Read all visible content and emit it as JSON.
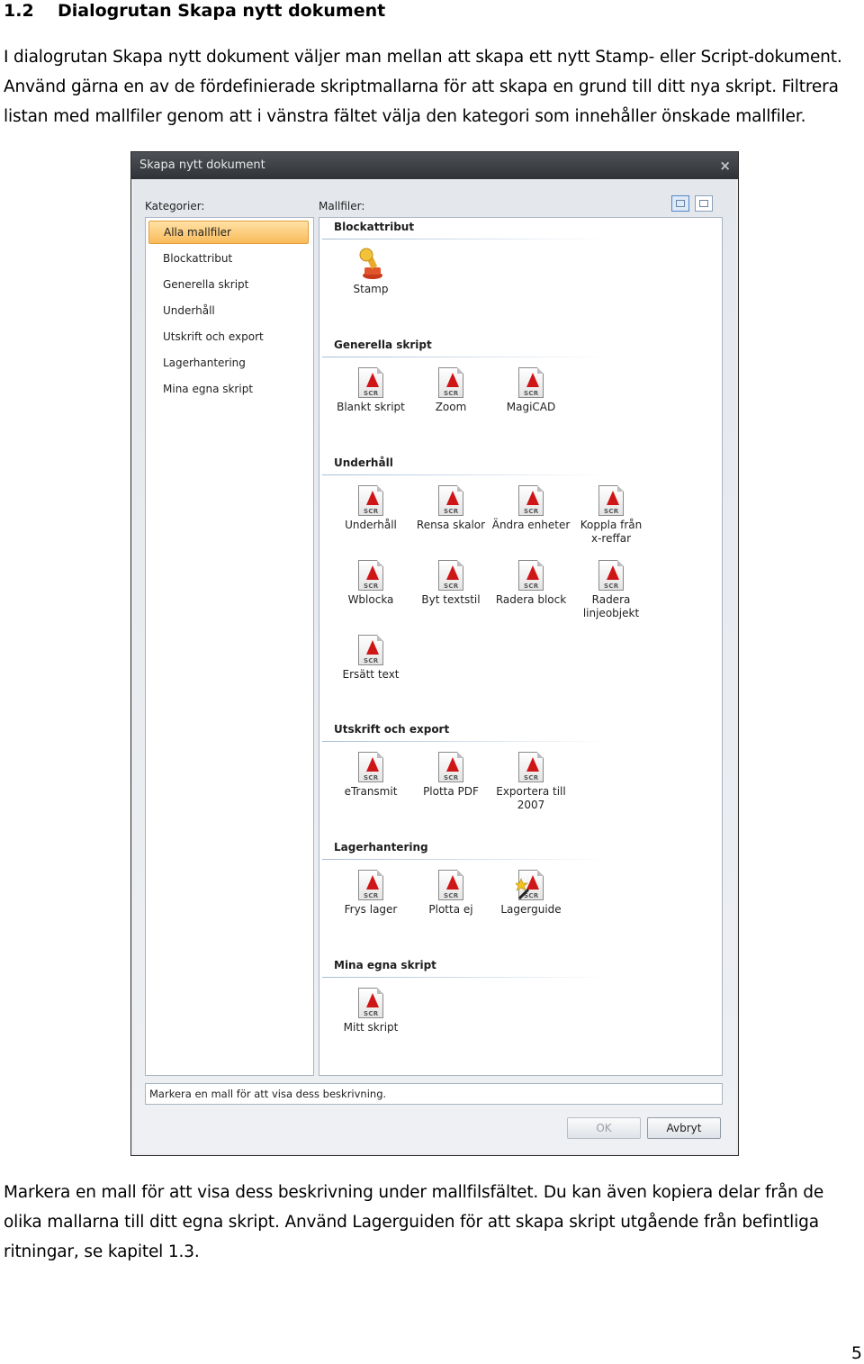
{
  "heading": {
    "number": "1.2",
    "title": "Dialogrutan Skapa nytt dokument"
  },
  "intro_lines": [
    "I dialogrutan Skapa nytt dokument väljer man mellan att skapa ett nytt Stamp- eller Script-dokument.",
    "Använd gärna en av de fördefinierade skriptmallarna för att skapa en grund till ditt nya skript. Filtrera",
    "listan med mallfiler genom att i vänstra fältet välja den kategori som innehåller önskade mallfiler."
  ],
  "dialog": {
    "title": "Skapa nytt dokument",
    "close_glyph": "×",
    "categories_label": "Kategorier:",
    "templates_label": "Mallfiler:",
    "categories": [
      "Alla mallfiler",
      "Blockattribut",
      "Generella skript",
      "Underhåll",
      "Utskrift och export",
      "Lagerhantering",
      "Mina egna skript"
    ],
    "selected_category": "Alla mallfiler",
    "sections": [
      {
        "title": "Blockattribut",
        "items": [
          {
            "name": "Stamp",
            "icon": "stamp-icon"
          }
        ]
      },
      {
        "title": "Generella skript",
        "items": [
          {
            "name": "Blankt skript",
            "icon": "script-file-icon"
          },
          {
            "name": "Zoom",
            "icon": "script-file-icon"
          },
          {
            "name": "MagiCAD",
            "icon": "script-file-icon"
          }
        ]
      },
      {
        "title": "Underhåll",
        "items": [
          {
            "name": "Underhåll",
            "icon": "script-file-icon"
          },
          {
            "name": "Rensa skalor",
            "icon": "script-file-icon"
          },
          {
            "name": "Ändra enheter",
            "icon": "script-file-icon"
          },
          {
            "name": "Koppla från\nx-reffar",
            "icon": "script-file-icon"
          },
          {
            "name": "Wblocka",
            "icon": "script-file-icon"
          },
          {
            "name": "Byt textstil",
            "icon": "script-file-icon"
          },
          {
            "name": "Radera block",
            "icon": "script-file-icon"
          },
          {
            "name": "Radera\nlinjeobjekt",
            "icon": "script-file-icon"
          },
          {
            "name": "Ersätt text",
            "icon": "script-file-icon"
          }
        ]
      },
      {
        "title": "Utskrift och export",
        "items": [
          {
            "name": "eTransmit",
            "icon": "script-file-icon"
          },
          {
            "name": "Plotta PDF",
            "icon": "script-file-icon"
          },
          {
            "name": "Exportera till\n2007",
            "icon": "script-file-icon"
          }
        ]
      },
      {
        "title": "Lagerhantering",
        "items": [
          {
            "name": "Frys lager",
            "icon": "script-file-icon"
          },
          {
            "name": "Plotta ej",
            "icon": "script-file-icon"
          },
          {
            "name": "Lagerguide",
            "icon": "wizard-script-icon"
          }
        ]
      },
      {
        "title": "Mina egna skript",
        "items": [
          {
            "name": "Mitt skript",
            "icon": "script-file-icon"
          }
        ]
      }
    ],
    "scr_label": "SCR",
    "description": "Markera en mall för att visa dess beskrivning.",
    "ok_label": "OK",
    "cancel_label": "Avbryt"
  },
  "outro_lines": [
    "Markera en mall för att visa dess beskrivning under mallfilsfältet. Du kan även kopiera delar från de",
    "olika mallarna till ditt egna skript. Använd Lagerguiden för att skapa skript utgående från befintliga",
    "ritningar, se kapitel 1.3."
  ],
  "page_number": "5",
  "colors": {
    "selection": "#f9bb5a",
    "titlebar": "#3a3d41",
    "acad_red": "#cf1616"
  }
}
